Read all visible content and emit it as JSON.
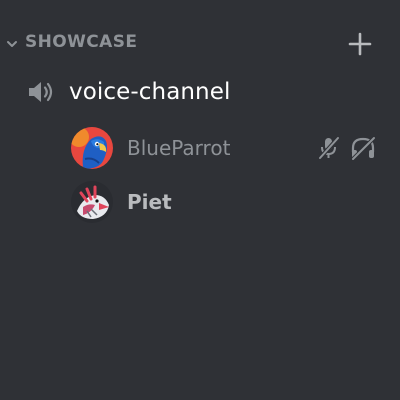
{
  "category": {
    "title": "SHOWCASE",
    "chevron_icon": "chevron-down-icon",
    "add_icon": "plus-icon"
  },
  "channel": {
    "name": "voice-channel",
    "icon": "speaker-icon"
  },
  "users": [
    {
      "name": "BlueParrot",
      "avatar": "blue-parrot-avatar",
      "muted": true,
      "deafened": true,
      "status_icons": [
        "mic-muted-icon",
        "headphones-deafened-icon"
      ]
    },
    {
      "name": "Piet",
      "avatar": "bird-avatar",
      "muted": false,
      "deafened": false,
      "status_icons": []
    }
  ],
  "colors": {
    "background": "#2f3136",
    "category_text": "#8e9297",
    "channel_text": "#ffffff",
    "muted_user_text": "#8e9297",
    "user_text": "#b9bbbe",
    "icon_gray": "#8e9297"
  }
}
